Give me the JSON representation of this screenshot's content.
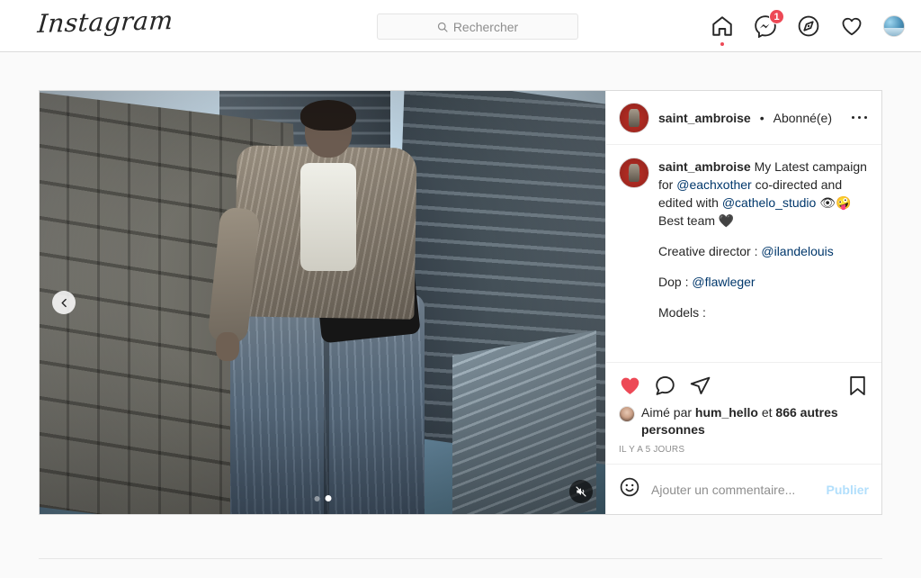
{
  "navbar": {
    "brand": "Instagram",
    "search": {
      "placeholder": "Rechercher",
      "icon": "search-icon",
      "value": ""
    },
    "icons": [
      {
        "name": "home-icon",
        "has_dot": true
      },
      {
        "name": "messenger-icon",
        "badge": "1"
      },
      {
        "name": "explore-compass-icon"
      },
      {
        "name": "activity-heart-icon"
      },
      {
        "name": "profile-avatar"
      }
    ]
  },
  "post": {
    "header": {
      "avatar": "saint-ambroise-avatar",
      "username": "saint_ambroise",
      "separator": "•",
      "follow_state": "Abonné(e)",
      "more_options": "more-options-icon"
    },
    "media": {
      "prev_icon": "chevron-left-icon",
      "mute_icon": "mute-speaker-icon",
      "dots": [
        {
          "active": false
        },
        {
          "active": true
        }
      ]
    },
    "caption": {
      "author": "saint_ambroise",
      "line1_text": " My Latest campaign for ",
      "mention1": "@eachxother",
      "line1_cont": " co-directed and edited with ",
      "mention2": "@cathelo_studio",
      "emoji1": "👁",
      "emoji2": "🤪",
      "line2": "Best team ",
      "emoji3": "🖤",
      "para2_label": "Creative director : ",
      "para2_mention": "@ilandelouis",
      "para3_label": "Dop : ",
      "para3_mention": "@flawleger",
      "para4_label": "Models :"
    },
    "actions": {
      "like_icon": "heart-filled-icon",
      "like_active": true,
      "comment_icon": "comment-bubble-icon",
      "share_icon": "share-paper-plane-icon",
      "save_icon": "bookmark-icon"
    },
    "likes": {
      "prefix": "Aimé par ",
      "username": "hum_hello",
      "middle": " et ",
      "count_text": "866 autres personnes"
    },
    "timestamp": "IL Y A 5 JOURS",
    "comment_bar": {
      "emoji_icon": "emoji-smiley-icon",
      "placeholder": "Ajouter un commentaire...",
      "value": "",
      "publish_label": "Publier"
    }
  },
  "colors": {
    "accent_red": "#ed4956",
    "link_blue": "#00376b",
    "publish_blue": "#b2dffc",
    "text": "#262626",
    "muted": "#8e8e8e"
  }
}
